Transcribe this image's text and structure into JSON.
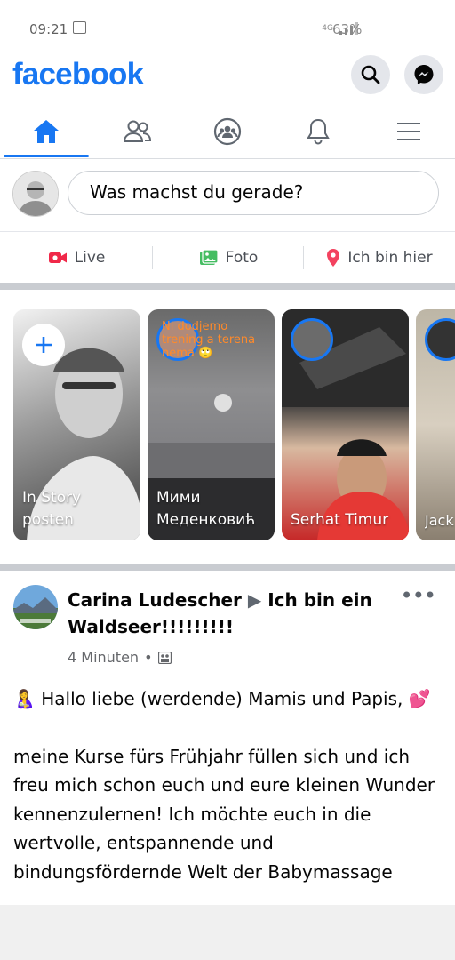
{
  "status_bar": {
    "time": "09:21",
    "network": "4G",
    "battery": "63%"
  },
  "header": {
    "brand": "facebook"
  },
  "tabs": [
    {
      "name": "home",
      "active": true
    },
    {
      "name": "friends",
      "active": false
    },
    {
      "name": "groups",
      "active": false
    },
    {
      "name": "notifications",
      "active": false
    },
    {
      "name": "menu",
      "active": false
    }
  ],
  "composer": {
    "placeholder": "Was machst du gerade?"
  },
  "actions": [
    {
      "label": "Live",
      "icon": "live-video-icon",
      "color": "#f02849"
    },
    {
      "label": "Foto",
      "icon": "photo-icon",
      "color": "#45bd62"
    },
    {
      "label": "Ich bin hier",
      "icon": "location-pin-icon",
      "color": "#f3425f"
    }
  ],
  "stories": [
    {
      "name": "In Story posten",
      "type": "create"
    },
    {
      "name": "Мими Меденковић",
      "overlay_text": "Ni dodjemo trening a terena nema 🙄"
    },
    {
      "name": "Serhat Timur"
    },
    {
      "name": "Jack Serc"
    }
  ],
  "post": {
    "author": "Carina Ludescher",
    "arrow": "▶",
    "place": "Ich bin ein Waldseer!!!!!!!!!",
    "time": "4 Minuten",
    "more": "•••",
    "line1": "🤱 Hallo liebe (werdende) Mamis und Papis, 💕",
    "line2": "meine Kurse fürs Frühjahr füllen sich und ich freu mich schon euch und eure kleinen Wunder kennenzulernen! Ich möchte euch in die wertvolle, entspannende und bindungsfördernde Welt der Babymassage"
  },
  "colors": {
    "accent": "#1877f2",
    "divider": "#c9ccd1"
  }
}
